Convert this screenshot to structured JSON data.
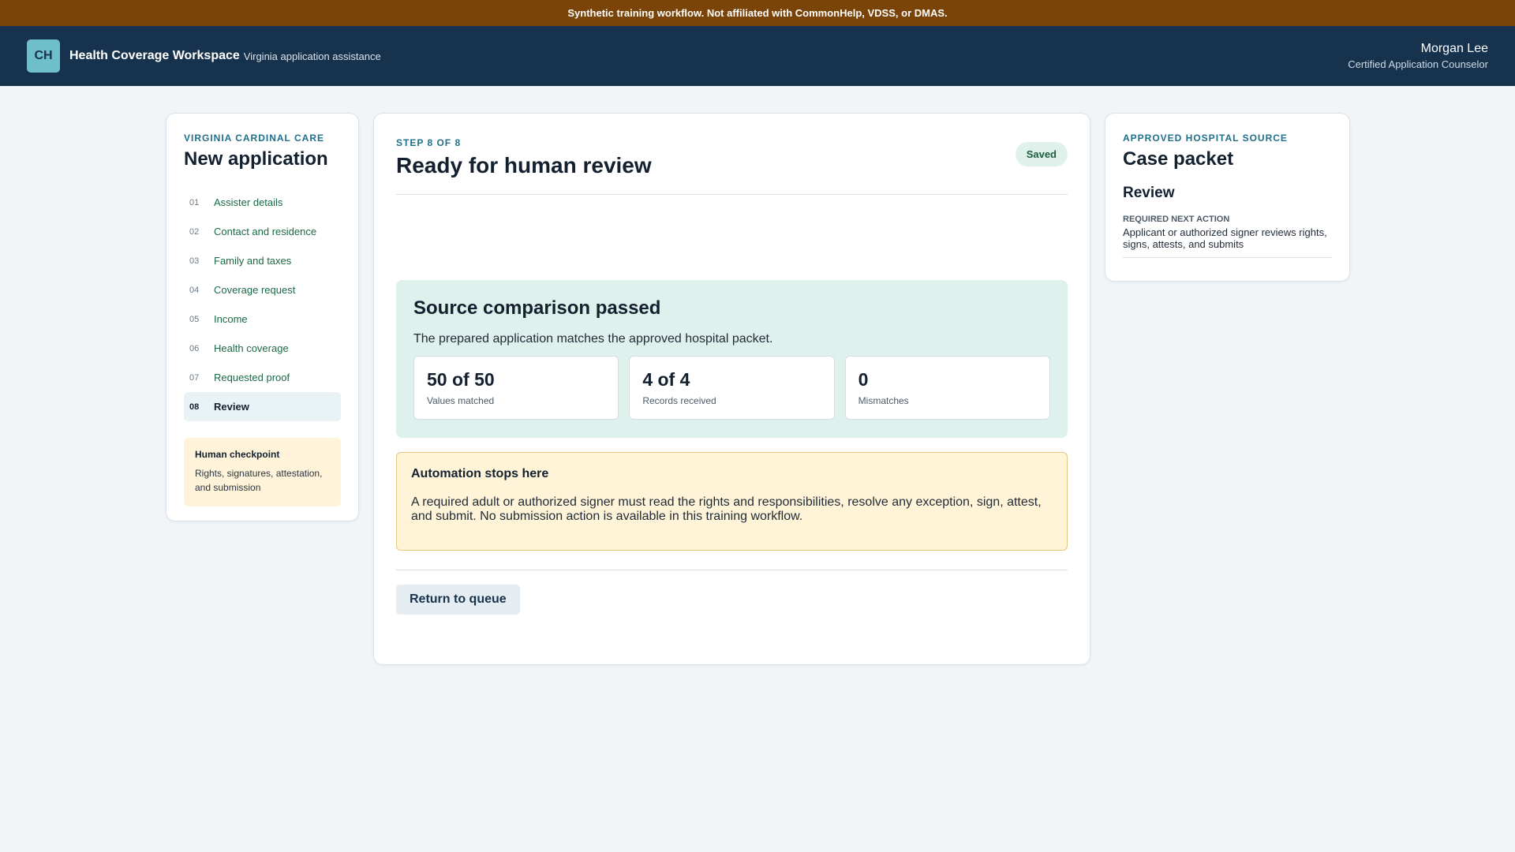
{
  "banner": {
    "text": "Synthetic training workflow. Not affiliated with CommonHelp, VDSS, or DMAS."
  },
  "header": {
    "logo": "CH",
    "title": "Health Coverage Workspace",
    "subtitle": "Virginia application assistance",
    "user_name": "Morgan Lee",
    "user_role": "Certified Application Counselor"
  },
  "sidebar": {
    "eyebrow": "Virginia Cardinal Care",
    "title": "New application",
    "steps": [
      {
        "num": "01",
        "label": "Assister details"
      },
      {
        "num": "02",
        "label": "Contact and residence"
      },
      {
        "num": "03",
        "label": "Family and taxes"
      },
      {
        "num": "04",
        "label": "Coverage request"
      },
      {
        "num": "05",
        "label": "Income"
      },
      {
        "num": "06",
        "label": "Health coverage"
      },
      {
        "num": "07",
        "label": "Requested proof"
      },
      {
        "num": "08",
        "label": "Review"
      }
    ],
    "active_step": 8,
    "checkpoint": {
      "title": "Human checkpoint",
      "text": "Rights, signatures, attestation, and submission"
    }
  },
  "main": {
    "step_label": "STEP 8 OF 8",
    "title": "Ready for human review",
    "saved_badge": "Saved",
    "comparison": {
      "title": "Source comparison passed",
      "text": "The prepared application matches the approved hospital packet.",
      "stats": [
        {
          "value": "50 of 50",
          "label": "Values matched"
        },
        {
          "value": "4 of 4",
          "label": "Records received"
        },
        {
          "value": "0",
          "label": "Mismatches"
        }
      ]
    },
    "stops": {
      "title": "Automation stops here",
      "text": "A required adult or authorized signer must read the rights and responsibilities, resolve any exception, sign, attest, and submit. No submission action is available in this training workflow."
    },
    "return_button": "Return to queue"
  },
  "right_panel": {
    "eyebrow": "Approved hospital source",
    "title": "Case packet",
    "subtitle": "Review",
    "next_action_label": "Required next action",
    "next_action_text": "Applicant or authorized signer reviews rights, signs, attests, and submits"
  }
}
